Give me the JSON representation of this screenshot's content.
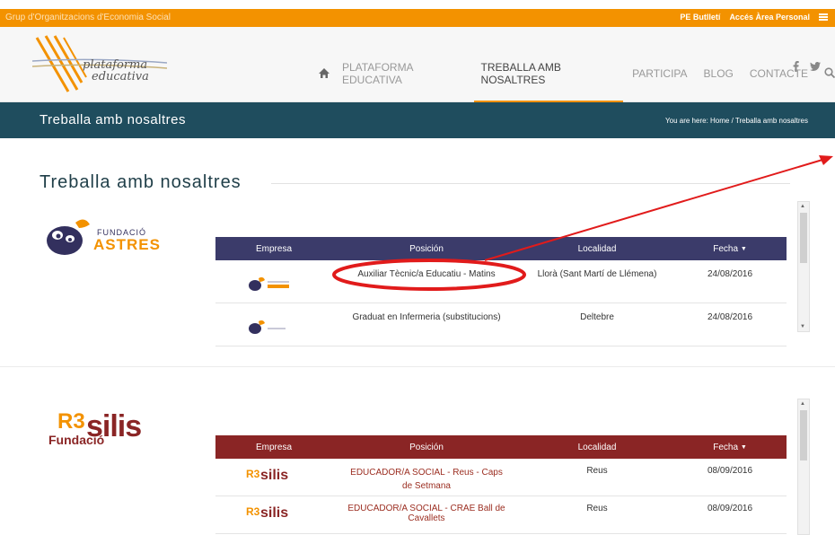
{
  "topbar": {
    "org": "Grup d'Organitzacions d'Economia Social",
    "link1": "PE Butlletí",
    "link2": "Accés Àrea Personal"
  },
  "logo": {
    "line1": "plataforma",
    "line2": "educativa"
  },
  "nav": {
    "items": [
      "PLATAFORMA EDUCATIVA",
      "TREBALLA AMB NOSALTRES",
      "PARTICIPA",
      "BLOG",
      "CONTACTE"
    ]
  },
  "banner": {
    "title": "Treballa amb nosaltres",
    "crumbs_prefix": "You are here:",
    "crumb_home": "Home",
    "crumb_sep": "/",
    "crumb_current": "Treballa amb nosaltres"
  },
  "page": {
    "heading": "Treballa amb nosaltres"
  },
  "astres": {
    "logo_small": "FUNDACIÓ",
    "logo_big": "ASTRES",
    "headers": [
      "Empresa",
      "Posición",
      "Localidad",
      "Fecha"
    ],
    "rows": [
      {
        "position": "Auxiliar Tècnic/a Educatiu - Matins",
        "location": "Llorà (Sant Martí de Llémena)",
        "date": "24/08/2016"
      },
      {
        "position": "Graduat en Infermeria (substitucions)",
        "location": "Deltebre",
        "date": "24/08/2016"
      }
    ]
  },
  "resilis": {
    "logo_top": "R3",
    "logo_word": "silis",
    "logo_sub": "Fundació",
    "headers": [
      "Empresa",
      "Posición",
      "Localidad",
      "Fecha"
    ],
    "rows": [
      {
        "position": "EDUCADOR/A SOCIAL - Reus - Caps de Setmana",
        "location": "Reus",
        "date": "08/09/2016"
      },
      {
        "position": "EDUCADOR/A SOCIAL - CRAE Ball de Cavallets",
        "location": "Reus",
        "date": "08/09/2016"
      }
    ]
  },
  "colors": {
    "topbar": "#f39200",
    "banner": "#1f4d5e",
    "astres_header": "#3b3b6a",
    "resilis_header": "#8a2525",
    "annotation": "#e11b1b"
  },
  "icons": {
    "home": "home-icon",
    "search": "search-icon",
    "facebook": "facebook-icon",
    "twitter": "twitter-icon",
    "menu": "menu-icon",
    "sort": "sort-down-icon"
  }
}
